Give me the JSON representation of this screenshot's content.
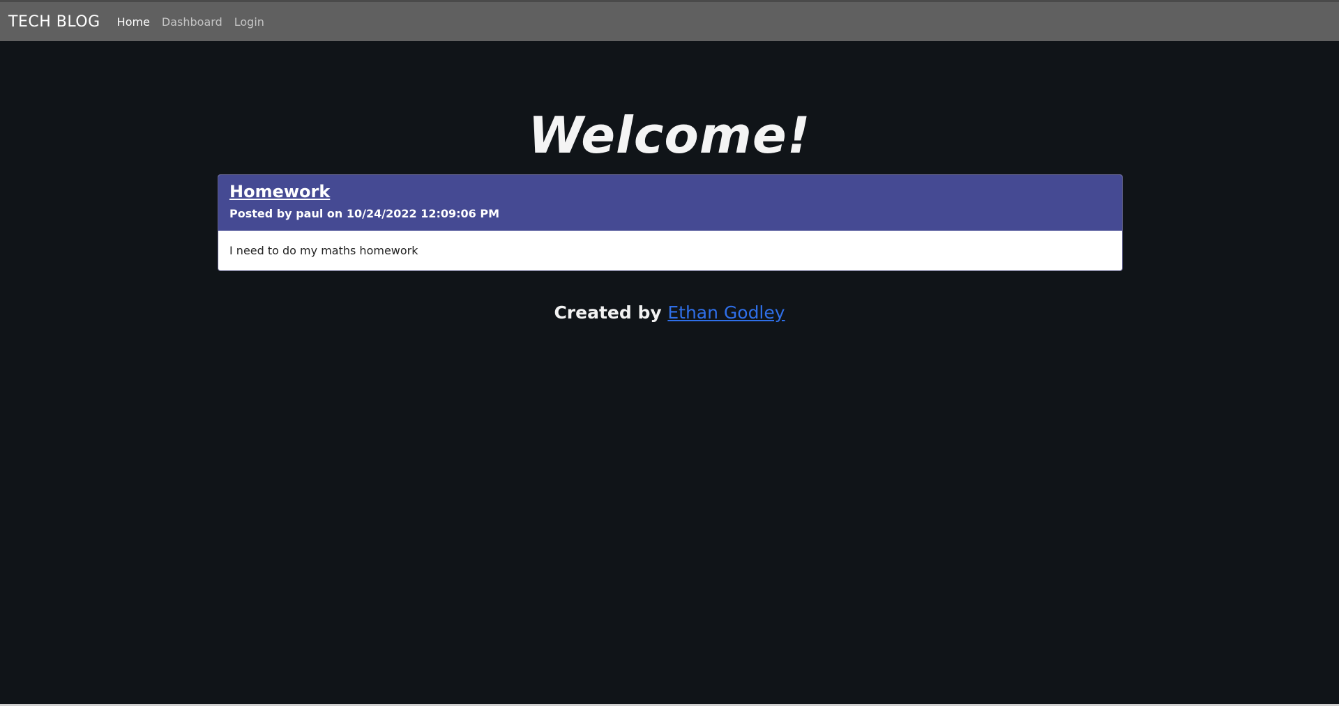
{
  "navbar": {
    "brand": "TECH BLOG",
    "links": [
      {
        "label": "Home",
        "active": true
      },
      {
        "label": "Dashboard",
        "active": false
      },
      {
        "label": "Login",
        "active": false
      }
    ]
  },
  "main": {
    "heading": "Welcome!",
    "posts": [
      {
        "title": "Homework",
        "meta": "Posted by paul on 10/24/2022 12:09:06 PM",
        "body": "I need to do my maths homework"
      }
    ]
  },
  "footer": {
    "prefix": "Created by ",
    "author_link": "Ethan Godley"
  },
  "colors": {
    "background": "#101418",
    "navbar": "#606060",
    "card_header": "#454a93",
    "link": "#2f6fe8"
  }
}
